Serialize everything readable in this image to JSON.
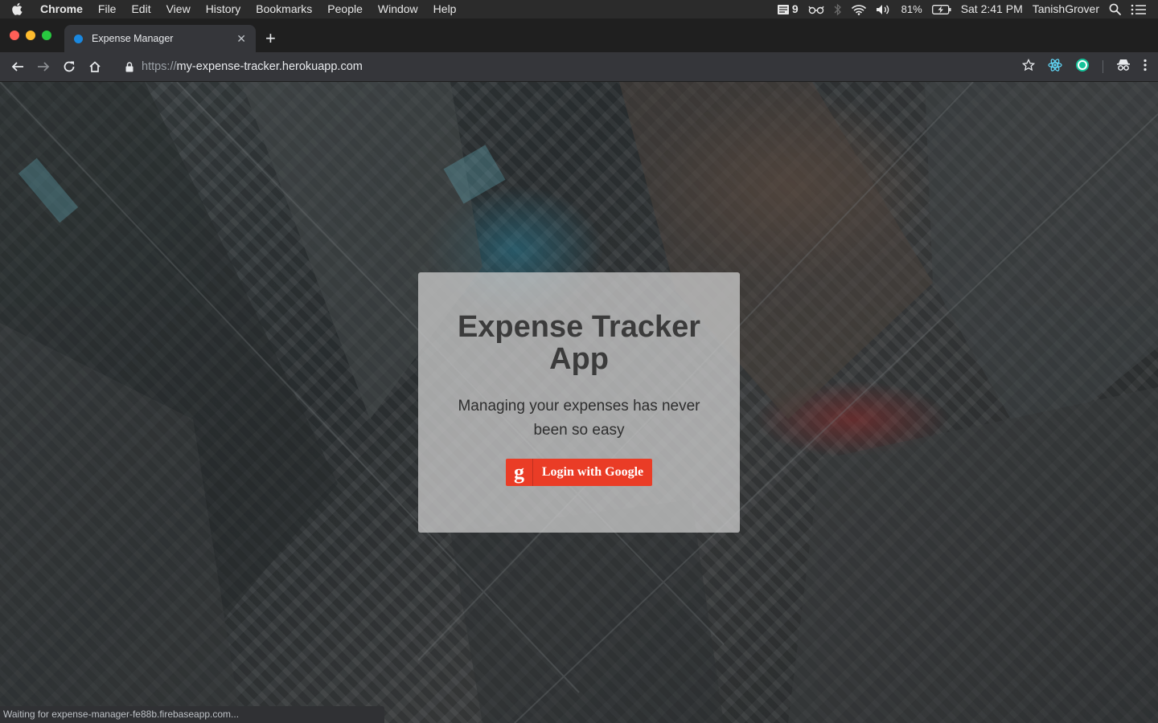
{
  "menubar": {
    "app": "Chrome",
    "items": [
      "File",
      "Edit",
      "View",
      "History",
      "Bookmarks",
      "People",
      "Window",
      "Help"
    ],
    "status": {
      "notif_count": "9",
      "battery": "81%",
      "clock": "Sat 2:41 PM",
      "user": "TanishGrover"
    }
  },
  "tab": {
    "title": "Expense Manager",
    "favicon_color": "#1a88e0"
  },
  "toolbar": {
    "url_scheme": "https://",
    "url_host": "my-expense-tracker.herokuapp.com"
  },
  "card": {
    "title": "Expense Tracker App",
    "subtitle": "Managing your expenses has never been so easy",
    "login_icon": "g",
    "login_label": "Login with Google",
    "login_color": "#ea3c26"
  },
  "status_bar": {
    "text": "Waiting for expense-manager-fe88b.firebaseapp.com..."
  }
}
